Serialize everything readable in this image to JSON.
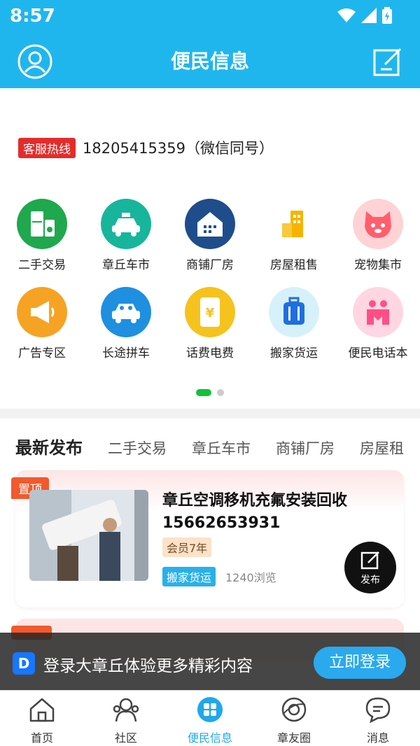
{
  "status": {
    "time": "8:57"
  },
  "header": {
    "title": "便民信息"
  },
  "hotline": {
    "tag": "客服热线",
    "number": "18205415359（微信同号）"
  },
  "categories": [
    {
      "label": "二手交易",
      "icon": "fridge-washer-icon",
      "color": "#1fa84e"
    },
    {
      "label": "章丘车市",
      "icon": "taxi-icon",
      "color": "#17b59c"
    },
    {
      "label": "商铺厂房",
      "icon": "house-icon",
      "color": "#1f4d8c"
    },
    {
      "label": "房屋租售",
      "icon": "buildings-icon",
      "color": "#f6b400"
    },
    {
      "label": "宠物集市",
      "icon": "pet-face-icon",
      "color": "#ff5f6d"
    },
    {
      "label": "广告专区",
      "icon": "megaphone-icon",
      "color": "#f6a323"
    },
    {
      "label": "长途拼车",
      "icon": "carpool-icon",
      "color": "#1f8fe0"
    },
    {
      "label": "话费电费",
      "icon": "phone-yuan-icon",
      "color": "#f6c21d"
    },
    {
      "label": "搬家货运",
      "icon": "suitcase-icon",
      "color": "#1f9be0"
    },
    {
      "label": "便民电话本",
      "icon": "phonebook-icon",
      "color": "#ff4f86"
    }
  ],
  "latest": {
    "heading": "最新发布",
    "tabs": [
      "二手交易",
      "章丘车市",
      "商铺厂房",
      "房屋租"
    ],
    "post": {
      "pin": "置顶",
      "title": "章丘空调移机充氟安装回收15662653931",
      "member": "会员7年",
      "category": "搬家货运",
      "views": "1240浏览"
    }
  },
  "fab": {
    "label": "发布"
  },
  "login_bar": {
    "message": "登录大章丘体验更多精彩内容",
    "button": "立即登录",
    "logo": "D"
  },
  "nav": [
    {
      "label": "首页",
      "icon": "home-icon"
    },
    {
      "label": "社区",
      "icon": "community-icon"
    },
    {
      "label": "便民信息",
      "icon": "grid-icon",
      "active": true
    },
    {
      "label": "章友圈",
      "icon": "planet-icon"
    },
    {
      "label": "消息",
      "icon": "message-icon"
    }
  ]
}
